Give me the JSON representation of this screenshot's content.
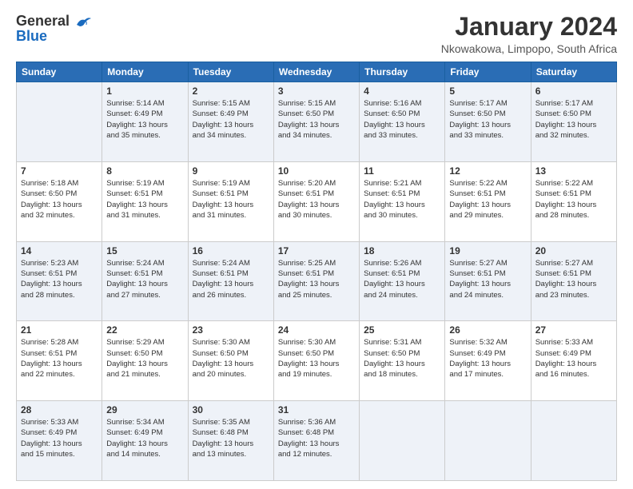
{
  "logo": {
    "line1": "General",
    "line2": "Blue"
  },
  "title": "January 2024",
  "subtitle": "Nkowakowa, Limpopo, South Africa",
  "weekdays": [
    "Sunday",
    "Monday",
    "Tuesday",
    "Wednesday",
    "Thursday",
    "Friday",
    "Saturday"
  ],
  "weeks": [
    [
      {
        "day": "",
        "info": ""
      },
      {
        "day": "1",
        "info": "Sunrise: 5:14 AM\nSunset: 6:49 PM\nDaylight: 13 hours\nand 35 minutes."
      },
      {
        "day": "2",
        "info": "Sunrise: 5:15 AM\nSunset: 6:49 PM\nDaylight: 13 hours\nand 34 minutes."
      },
      {
        "day": "3",
        "info": "Sunrise: 5:15 AM\nSunset: 6:50 PM\nDaylight: 13 hours\nand 34 minutes."
      },
      {
        "day": "4",
        "info": "Sunrise: 5:16 AM\nSunset: 6:50 PM\nDaylight: 13 hours\nand 33 minutes."
      },
      {
        "day": "5",
        "info": "Sunrise: 5:17 AM\nSunset: 6:50 PM\nDaylight: 13 hours\nand 33 minutes."
      },
      {
        "day": "6",
        "info": "Sunrise: 5:17 AM\nSunset: 6:50 PM\nDaylight: 13 hours\nand 32 minutes."
      }
    ],
    [
      {
        "day": "7",
        "info": "Sunrise: 5:18 AM\nSunset: 6:50 PM\nDaylight: 13 hours\nand 32 minutes."
      },
      {
        "day": "8",
        "info": "Sunrise: 5:19 AM\nSunset: 6:51 PM\nDaylight: 13 hours\nand 31 minutes."
      },
      {
        "day": "9",
        "info": "Sunrise: 5:19 AM\nSunset: 6:51 PM\nDaylight: 13 hours\nand 31 minutes."
      },
      {
        "day": "10",
        "info": "Sunrise: 5:20 AM\nSunset: 6:51 PM\nDaylight: 13 hours\nand 30 minutes."
      },
      {
        "day": "11",
        "info": "Sunrise: 5:21 AM\nSunset: 6:51 PM\nDaylight: 13 hours\nand 30 minutes."
      },
      {
        "day": "12",
        "info": "Sunrise: 5:22 AM\nSunset: 6:51 PM\nDaylight: 13 hours\nand 29 minutes."
      },
      {
        "day": "13",
        "info": "Sunrise: 5:22 AM\nSunset: 6:51 PM\nDaylight: 13 hours\nand 28 minutes."
      }
    ],
    [
      {
        "day": "14",
        "info": "Sunrise: 5:23 AM\nSunset: 6:51 PM\nDaylight: 13 hours\nand 28 minutes."
      },
      {
        "day": "15",
        "info": "Sunrise: 5:24 AM\nSunset: 6:51 PM\nDaylight: 13 hours\nand 27 minutes."
      },
      {
        "day": "16",
        "info": "Sunrise: 5:24 AM\nSunset: 6:51 PM\nDaylight: 13 hours\nand 26 minutes."
      },
      {
        "day": "17",
        "info": "Sunrise: 5:25 AM\nSunset: 6:51 PM\nDaylight: 13 hours\nand 25 minutes."
      },
      {
        "day": "18",
        "info": "Sunrise: 5:26 AM\nSunset: 6:51 PM\nDaylight: 13 hours\nand 24 minutes."
      },
      {
        "day": "19",
        "info": "Sunrise: 5:27 AM\nSunset: 6:51 PM\nDaylight: 13 hours\nand 24 minutes."
      },
      {
        "day": "20",
        "info": "Sunrise: 5:27 AM\nSunset: 6:51 PM\nDaylight: 13 hours\nand 23 minutes."
      }
    ],
    [
      {
        "day": "21",
        "info": "Sunrise: 5:28 AM\nSunset: 6:51 PM\nDaylight: 13 hours\nand 22 minutes."
      },
      {
        "day": "22",
        "info": "Sunrise: 5:29 AM\nSunset: 6:50 PM\nDaylight: 13 hours\nand 21 minutes."
      },
      {
        "day": "23",
        "info": "Sunrise: 5:30 AM\nSunset: 6:50 PM\nDaylight: 13 hours\nand 20 minutes."
      },
      {
        "day": "24",
        "info": "Sunrise: 5:30 AM\nSunset: 6:50 PM\nDaylight: 13 hours\nand 19 minutes."
      },
      {
        "day": "25",
        "info": "Sunrise: 5:31 AM\nSunset: 6:50 PM\nDaylight: 13 hours\nand 18 minutes."
      },
      {
        "day": "26",
        "info": "Sunrise: 5:32 AM\nSunset: 6:49 PM\nDaylight: 13 hours\nand 17 minutes."
      },
      {
        "day": "27",
        "info": "Sunrise: 5:33 AM\nSunset: 6:49 PM\nDaylight: 13 hours\nand 16 minutes."
      }
    ],
    [
      {
        "day": "28",
        "info": "Sunrise: 5:33 AM\nSunset: 6:49 PM\nDaylight: 13 hours\nand 15 minutes."
      },
      {
        "day": "29",
        "info": "Sunrise: 5:34 AM\nSunset: 6:49 PM\nDaylight: 13 hours\nand 14 minutes."
      },
      {
        "day": "30",
        "info": "Sunrise: 5:35 AM\nSunset: 6:48 PM\nDaylight: 13 hours\nand 13 minutes."
      },
      {
        "day": "31",
        "info": "Sunrise: 5:36 AM\nSunset: 6:48 PM\nDaylight: 13 hours\nand 12 minutes."
      },
      {
        "day": "",
        "info": ""
      },
      {
        "day": "",
        "info": ""
      },
      {
        "day": "",
        "info": ""
      }
    ]
  ]
}
